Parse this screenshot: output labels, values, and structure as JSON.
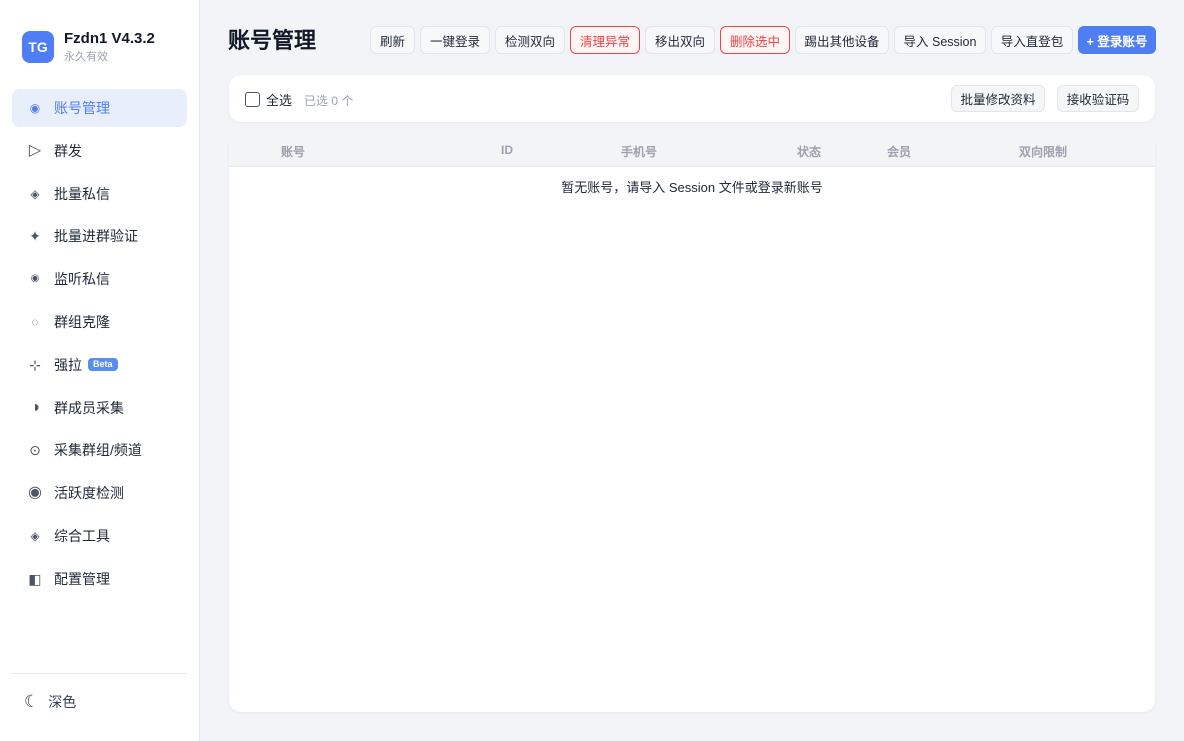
{
  "brand": {
    "logo": "TG",
    "title": "Fzdn1 V4.3.2",
    "subtitle": "永久有效"
  },
  "sidebar": {
    "items": [
      {
        "label": "账号管理",
        "icon": "◉"
      },
      {
        "label": "群发",
        "icon": "▷"
      },
      {
        "label": "批量私信",
        "icon": "◈"
      },
      {
        "label": "批量进群验证",
        "icon": "✦"
      },
      {
        "label": "监听私信",
        "icon": "◉"
      },
      {
        "label": "群组克隆",
        "icon": "◌"
      },
      {
        "label": "强拉",
        "icon": "⊹",
        "badge": "Beta"
      },
      {
        "label": "群成员采集",
        "icon": "◑"
      },
      {
        "label": "采集群组/频道",
        "icon": "⊙"
      },
      {
        "label": "活跃度检测",
        "icon": "◉"
      },
      {
        "label": "综合工具",
        "icon": "◈"
      },
      {
        "label": "配置管理",
        "icon": "◧"
      }
    ],
    "theme_label": "深色",
    "theme_icon": "☾"
  },
  "header": {
    "title": "账号管理"
  },
  "toolbar": {
    "refresh": "刷新",
    "one_click_login": "一键登录",
    "check_bidirectional": "检测双向",
    "clean_abnormal": "清理异常",
    "remove_bidirectional": "移出双向",
    "delete_selected": "删除选中",
    "kick_other_devices": "踢出其他设备",
    "import_session": "导入 Session",
    "import_direct_package": "导入直登包",
    "login_account": "+ 登录账号"
  },
  "selection": {
    "select_all_label": "全选",
    "selected_count": "已选 0 个"
  },
  "actions": {
    "batch_edit_profile": "批量修改资料",
    "receive_code": "接收验证码"
  },
  "table": {
    "columns": [
      "账号",
      "ID",
      "手机号",
      "状态",
      "会员",
      "双向限制"
    ],
    "empty_text": "暂无账号，请导入 Session 文件或登录新账号"
  },
  "colors": {
    "accent": "#4f7df3",
    "danger": "#ef4444",
    "background": "#f3f4f8"
  }
}
